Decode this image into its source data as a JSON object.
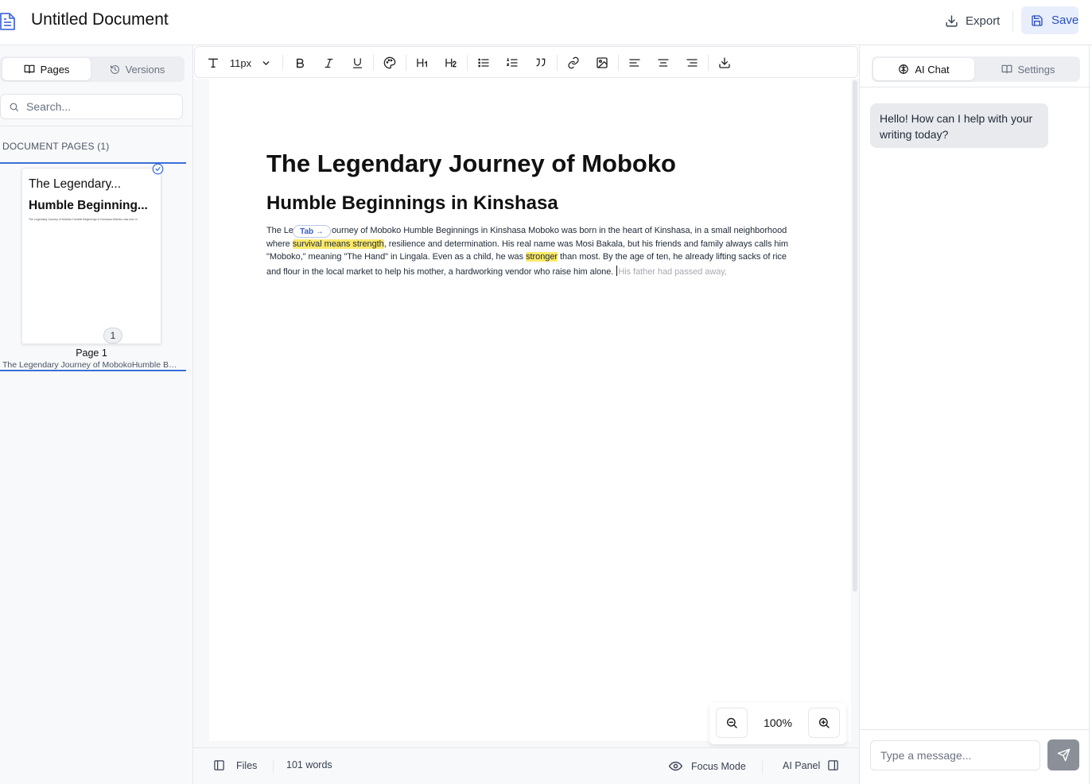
{
  "header": {
    "title": "Untitled Document",
    "export_label": "Export",
    "save_label": "Save"
  },
  "sidebar": {
    "tabs": [
      {
        "label": "Pages",
        "icon": "book-open-icon",
        "active": true
      },
      {
        "label": "Versions",
        "icon": "history-icon",
        "active": false
      }
    ],
    "search_placeholder": "Search...",
    "section_heading": "DOCUMENT PAGES (1)",
    "pages": [
      {
        "thumb_title": "The Legendary...",
        "thumb_heading": "Humble Beginning...",
        "thumb_text": "The Legendary Journey of Moboko Humble Beginnings in Kinshasa Moboko was born in",
        "number": "1",
        "name": "Page 1",
        "subtitle": "The Legendary Journey of MobokoHumble Beginnings in Kinshasa"
      }
    ]
  },
  "toolbar": {
    "font_size": "11px",
    "buttons": [
      "text-type-icon",
      "bold-icon",
      "italic-icon",
      "underline-icon",
      "palette-icon",
      "heading-1-icon",
      "heading-2-icon",
      "bullet-list-icon",
      "numbered-list-icon",
      "quote-icon",
      "link-icon",
      "image-icon",
      "align-left-icon",
      "align-center-icon",
      "align-right-icon",
      "download-icon"
    ]
  },
  "editor": {
    "heading1": "The Legendary Journey of Moboko",
    "heading2": "Humble Beginnings in Kinshasa",
    "line1_a": "The Le",
    "line1_b": "ourney of Moboko Humble Beginnings in Kinshasa Moboko was born in the heart of Kinshasa, in a small neighborhood",
    "line2_a": "where ",
    "line2_hl": "survival means strength",
    "line2_b": ", resilience and determination. His real name was Mosi Bakala, but his friends and family always calls him",
    "line3_a": "\"Moboko,\" meaning \"The Hand\" in Lingala. Even as a child, he was ",
    "line3_hl": "stronger",
    "line3_b": " than most. By the age of ten, he already lifting sacks of rice",
    "line4_a": "and flour in the local market to help his mother, a hardworking vendor who raise him alone. ",
    "line4_ghost": "His father had passed away,",
    "tab_hint": "Tab →"
  },
  "zoom": {
    "value": "100%"
  },
  "status": {
    "files_label": "Files",
    "word_count": "101 words",
    "focus_label": "Focus Mode",
    "ai_panel_label": "AI Panel"
  },
  "right_panel": {
    "tabs": [
      {
        "label": "AI Chat",
        "icon": "brain-icon",
        "active": true
      },
      {
        "label": "Settings",
        "icon": "book-icon",
        "active": false
      }
    ],
    "greeting": "Hello! How can I help with your writing today?",
    "input_placeholder": "Type a message..."
  },
  "colors": {
    "accent": "#3b6fd8",
    "save_bg": "#e8eefb",
    "highlight": "#fbe96a"
  }
}
